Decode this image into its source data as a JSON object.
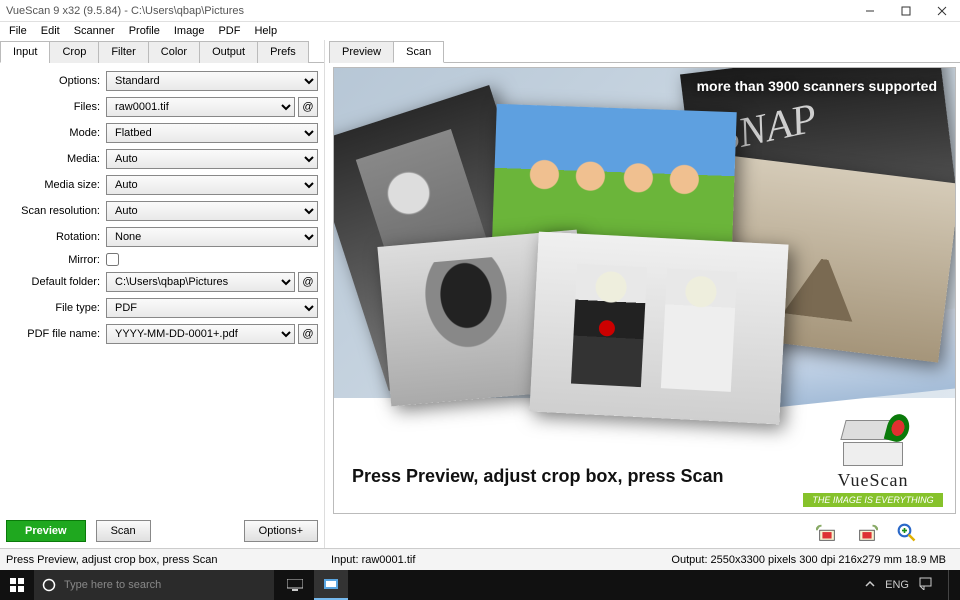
{
  "titlebar": {
    "title": "VueScan 9 x32 (9.5.84) - C:\\Users\\qbap\\Pictures"
  },
  "menu": [
    "File",
    "Edit",
    "Scanner",
    "Profile",
    "Image",
    "PDF",
    "Help"
  ],
  "left_tabs": [
    "Input",
    "Crop",
    "Filter",
    "Color",
    "Output",
    "Prefs"
  ],
  "left_active_tab": "Input",
  "right_tabs": [
    "Preview",
    "Scan"
  ],
  "right_active_tab": "Scan",
  "form": {
    "options": {
      "label": "Options:",
      "value": "Standard"
    },
    "files": {
      "label": "Files:",
      "value": "raw0001.tif"
    },
    "mode": {
      "label": "Mode:",
      "value": "Flatbed"
    },
    "media": {
      "label": "Media:",
      "value": "Auto"
    },
    "media_size": {
      "label": "Media size:",
      "value": "Auto"
    },
    "scan_res": {
      "label": "Scan resolution:",
      "value": "Auto"
    },
    "rotation": {
      "label": "Rotation:",
      "value": "None"
    },
    "mirror": {
      "label": "Mirror:",
      "checked": false
    },
    "default_folder": {
      "label": "Default folder:",
      "value": "C:\\Users\\qbap\\Pictures"
    },
    "file_type": {
      "label": "File type:",
      "value": "PDF"
    },
    "pdf_file_name": {
      "label": "PDF file name:",
      "value": "YYYY-MM-DD-0001+.pdf"
    }
  },
  "buttons": {
    "preview": "Preview",
    "scan": "Scan",
    "options": "Options+"
  },
  "preview": {
    "banner": "more than 3900 scanners supported",
    "instruction": "Press Preview, adjust crop box, press Scan",
    "brand": "VueScan",
    "tagline": "THE IMAGE IS EVERYTHING"
  },
  "status": {
    "left": "Press Preview, adjust crop box, press Scan",
    "center": "Input: raw0001.tif",
    "right": "Output: 2550x3300 pixels 300 dpi 216x279 mm 18.9 MB"
  },
  "taskbar": {
    "search_placeholder": "Type here to search",
    "lang": "ENG"
  },
  "at": "@"
}
